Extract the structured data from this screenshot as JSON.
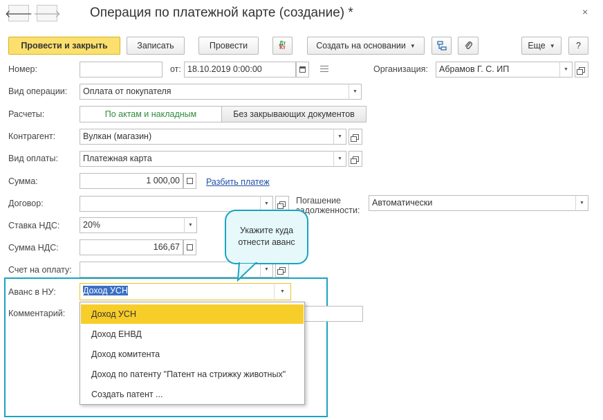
{
  "window": {
    "title": "Операция по платежной карте (создание) *",
    "close_glyph": "×",
    "back_glyph": "🡐",
    "forward_glyph": "🡒"
  },
  "toolbar": {
    "post_close_label": "Провести и закрыть",
    "save_label": "Записать",
    "post_label": "Провести",
    "dt_kt_label": "Дт Кт",
    "create_based_label": "Создать на основании",
    "more_label": "Еще",
    "help_label": "?"
  },
  "form": {
    "number_label": "Номер:",
    "number_value": "",
    "date_prefix": "от:",
    "date_value": "18.10.2019  0:00:00",
    "org_label": "Организация:",
    "org_value": "Абрамов Г. С. ИП",
    "operation_label": "Вид операции:",
    "operation_value": "Оплата от покупателя",
    "settlements_label": "Расчеты:",
    "settlements_opt1": "По актам и накладным",
    "settlements_opt2": "Без закрывающих документов",
    "counterparty_label": "Контрагент:",
    "counterparty_value": "Вулкан (магазин)",
    "payment_type_label": "Вид оплаты:",
    "payment_type_value": "Платежная карта",
    "amount_label": "Сумма:",
    "amount_value": "1 000,00",
    "split_payment_link": "Разбить платеж",
    "contract_label": "Договор:",
    "contract_value": "",
    "debt_repay_label_line1": "Погашение",
    "debt_repay_label_line2": "задолженности:",
    "debt_repay_value": "Автоматически",
    "vat_rate_label": "Ставка НДС:",
    "vat_rate_value": "20%",
    "vat_amount_label": "Сумма НДС:",
    "vat_amount_value": "166,67",
    "invoice_label": "Счет на оплату:",
    "invoice_value": "",
    "advance_label": "Аванс в НУ:",
    "advance_value": "Доход УСН",
    "comment_label": "Комментарий:",
    "comment_value": ""
  },
  "tooltip": {
    "line1": "Укажите куда",
    "line2": "отнести аванс"
  },
  "dropdown": {
    "options": [
      "Доход УСН",
      "Доход ЕНВД",
      "Доход комитента",
      "Доход по патенту \"Патент на стрижку животных\"",
      "Создать патент ..."
    ],
    "selected_index": 0
  },
  "colors": {
    "primary_button": "#fbe06e",
    "selected_option": "#f7cd2a",
    "highlight_frame": "#1aa3c2",
    "link": "#1f4fa5",
    "segment_active_text": "#2e8b3a"
  }
}
